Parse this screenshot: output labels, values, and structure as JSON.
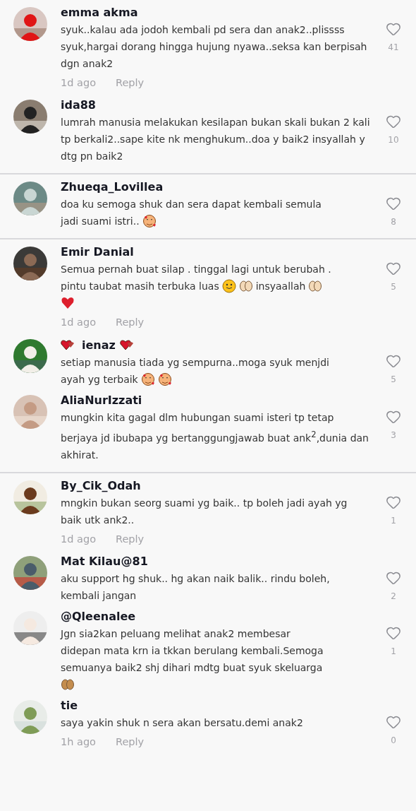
{
  "panels": [
    {
      "comments": [
        {
          "name": [
            {
              "kind": "text",
              "text": "emma akma"
            }
          ],
          "body": [
            {
              "kind": "text",
              "text": "syuk..kalau ada jodoh kembali pd sera dan anak2..plissss syuk,hargai dorang hingga hujung nyawa..seksa kan berpisah dgn anak2"
            }
          ],
          "likes": "41",
          "meta": {
            "time": "1d ago",
            "reply": "Reply"
          }
        },
        {
          "name": [
            {
              "kind": "text",
              "text": "ida88"
            }
          ],
          "body": [
            {
              "kind": "text",
              "text": "lumrah manusia melakukan kesilapan bukan skali bukan 2 kali tp berkali2..sape kite nk menghukum..doa y baik2 insyallah y dtg pn baik2"
            }
          ],
          "likes": "10"
        }
      ]
    },
    {
      "comments": [
        {
          "name": [
            {
              "kind": "text",
              "text": "Zhueqa_Lovillea"
            }
          ],
          "body": [
            [
              {
                "kind": "text",
                "text": "doa ku semoga shuk dan sera dapat kembali semula"
              }
            ],
            [
              {
                "kind": "text",
                "text": "jadi suami istri.."
              },
              {
                "kind": "hearts-face"
              }
            ]
          ],
          "likes": "8"
        }
      ]
    },
    {
      "comments": [
        {
          "name": [
            {
              "kind": "text",
              "text": "Emir Danial"
            }
          ],
          "body": [
            [
              {
                "kind": "text",
                "text": "Semua pernah buat silap . tinggal lagi untuk berubah ."
              }
            ],
            [
              {
                "kind": "text",
                "text": "pintu taubat masih terbuka luas"
              },
              {
                "kind": "smile"
              },
              {
                "kind": "palms"
              },
              {
                "kind": "text",
                "text": "insyaallah"
              },
              {
                "kind": "palms"
              }
            ],
            [
              {
                "kind": "heart"
              }
            ]
          ],
          "likes": "5",
          "meta": {
            "time": "1d ago",
            "reply": "Reply"
          }
        },
        {
          "name": [
            {
              "kind": "heart-pair"
            },
            {
              "kind": "text",
              "text": "ienaz"
            },
            {
              "kind": "heart-pair"
            }
          ],
          "body": [
            [
              {
                "kind": "text",
                "text": "setiap manusia tiada yg sempurna..moga syuk menjdi"
              }
            ],
            [
              {
                "kind": "text",
                "text": "ayah yg terbaik"
              },
              {
                "kind": "hearts-face"
              },
              {
                "kind": "hearts-face"
              }
            ]
          ],
          "likes": "5"
        },
        {
          "name": [
            {
              "kind": "text",
              "text": "AliaNurIzzati"
            }
          ],
          "body": [
            {
              "kind": "text",
              "text": "mungkin kita gagal dlm hubungan suami isteri tp tetap berjaya jd ibubapa yg bertanggungjawab buat ank$^{2}$,dunia dan akhirat."
            }
          ],
          "likes": "3"
        }
      ]
    },
    {
      "comments": [
        {
          "name": [
            {
              "kind": "text",
              "text": "By_Cik_Odah"
            }
          ],
          "body": [
            {
              "kind": "text",
              "text": "mngkin bukan seorg suami yg baik.. tp boleh jadi ayah yg baik utk ank2.."
            }
          ],
          "likes": "1",
          "meta": {
            "time": "1d ago",
            "reply": "Reply"
          }
        },
        {
          "name": [
            {
              "kind": "text",
              "text": "Mat Kilau@81"
            }
          ],
          "body": [
            {
              "kind": "text",
              "text": "aku support hg shuk.. hg akan naik balik.. rindu boleh, kembali jangan"
            }
          ],
          "likes": "2"
        },
        {
          "name": [
            {
              "kind": "text",
              "text": "@Qleenalee"
            }
          ],
          "body": [
            [
              {
                "kind": "text",
                "text": "Jgn sia2kan peluang melihat anak2 membesar"
              }
            ],
            [
              {
                "kind": "text",
                "text": "didepan mata krn ia tkkan berulang kembali.Semoga"
              }
            ],
            [
              {
                "kind": "text",
                "text": "semuanya baik2 shj dihari mdtg buat syuk skeluarga"
              }
            ],
            [
              {
                "kind": "palms-dark"
              }
            ]
          ],
          "likes": "1"
        },
        {
          "name": [
            {
              "kind": "text",
              "text": "tie"
            }
          ],
          "body": [
            {
              "kind": "text",
              "text": "saya yakin shuk n sera akan bersatu.demi anak2"
            }
          ],
          "likes": "0",
          "meta": {
            "time": "1h ago",
            "reply": "Reply"
          }
        }
      ]
    }
  ]
}
